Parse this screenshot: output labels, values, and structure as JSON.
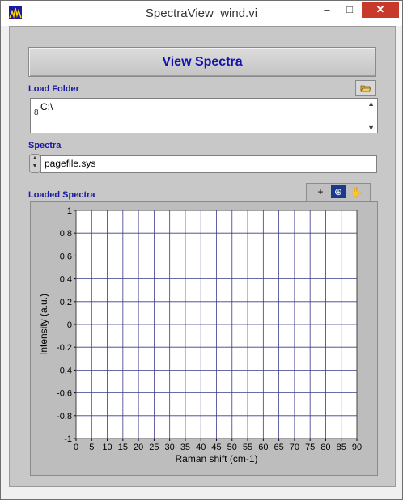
{
  "window": {
    "title": "SpectraView_wind.vi",
    "min_label": "–",
    "max_label": "□",
    "close_label": "✕"
  },
  "main": {
    "view_button_label": "View Spectra"
  },
  "load_folder": {
    "label": "Load Folder",
    "folder_icon": "folder-open-icon",
    "value": "C:\\",
    "path_marker": "8"
  },
  "spectra": {
    "label": "Spectra",
    "value": "pagefile.sys"
  },
  "graph": {
    "label": "Loaded Spectra",
    "tools": [
      "cursor-tool-icon",
      "zoom-tool-icon",
      "hand-tool-icon"
    ],
    "tool_glyphs": [
      "+",
      "⊕",
      "✋"
    ]
  },
  "chart_data": {
    "type": "line",
    "xlabel": "Raman shift (cm-1)",
    "ylabel": "Intensity (a.u.)",
    "xlim": [
      0,
      90
    ],
    "ylim": [
      -1,
      1
    ],
    "xticks": [
      0,
      5,
      10,
      15,
      20,
      25,
      30,
      35,
      40,
      45,
      50,
      55,
      60,
      65,
      70,
      75,
      80,
      85,
      90
    ],
    "yticks": [
      1,
      0.8,
      0.6,
      0.4,
      0.2,
      0,
      -0.2,
      -0.4,
      -0.6,
      -0.8,
      -1
    ],
    "ytick_labels": [
      "1",
      "0.8",
      "0.6",
      "0.4",
      "0.2",
      "0",
      "-0.2",
      "-0.4",
      "-0.6",
      "-0.8",
      "-1"
    ],
    "grid": true,
    "series": [],
    "grid_color": "#3a3a8a",
    "plot_bg": "#ffffff"
  }
}
